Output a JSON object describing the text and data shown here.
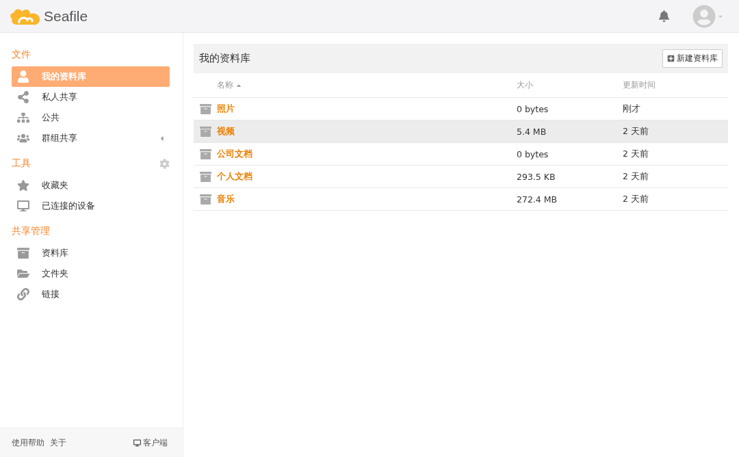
{
  "header": {
    "logo": "Seafile"
  },
  "sidebar": {
    "sections": [
      {
        "title": "文件",
        "has_settings": false,
        "items": [
          {
            "label": "我的资料库",
            "selected": true,
            "expandable": false
          },
          {
            "label": "私人共享",
            "selected": false,
            "expandable": false
          },
          {
            "label": "公共",
            "selected": false,
            "expandable": false
          },
          {
            "label": "群组共享",
            "selected": false,
            "expandable": true
          }
        ]
      },
      {
        "title": "工具",
        "has_settings": true,
        "items": [
          {
            "label": "收藏夹",
            "selected": false,
            "expandable": false
          },
          {
            "label": "已连接的设备",
            "selected": false,
            "expandable": false
          }
        ]
      },
      {
        "title": "共享管理",
        "has_settings": false,
        "items": [
          {
            "label": "资料库",
            "selected": false,
            "expandable": false
          },
          {
            "label": "文件夹",
            "selected": false,
            "expandable": false
          },
          {
            "label": "链接",
            "selected": false,
            "expandable": false
          }
        ]
      }
    ],
    "footer": {
      "links": [
        "使用帮助",
        "关于"
      ],
      "client": "客户端"
    }
  },
  "main": {
    "title": "我的资料库",
    "new_button": "新建资料库",
    "table": {
      "columns": [
        {
          "label": "名称",
          "sorted": true
        },
        {
          "label": "大小",
          "sorted": false
        },
        {
          "label": "更新时间",
          "sorted": false
        }
      ],
      "rows": [
        {
          "name": "照片",
          "size": "0 bytes",
          "updated": "刚才",
          "highlighted": false
        },
        {
          "name": "视频",
          "size": "5.4 MB",
          "updated": "2 天前",
          "highlighted": true
        },
        {
          "name": "公司文档",
          "size": "0 bytes",
          "updated": "2 天前",
          "highlighted": false
        },
        {
          "name": "个人文档",
          "size": "293.5 KB",
          "updated": "2 天前",
          "highlighted": false
        },
        {
          "name": "音乐",
          "size": "272.4 MB",
          "updated": "2 天前",
          "highlighted": false
        }
      ]
    }
  }
}
